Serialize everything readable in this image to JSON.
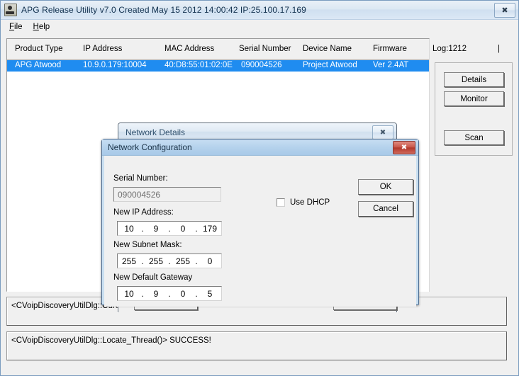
{
  "window": {
    "title": "APG Release Utility v7.0 Created May 15 2012 14:00:42   IP:25.100.17.169",
    "close_glyph": "✖",
    "icon_name": "app-icon"
  },
  "menu": {
    "items": [
      {
        "label": "File",
        "accel": "F"
      },
      {
        "label": "Help",
        "accel": "H"
      }
    ]
  },
  "device_list": {
    "columns": [
      "Product Type",
      "IP Address",
      "MAC Address",
      "Serial Number",
      "Device Name",
      "Firmware",
      "Log:1212",
      "|"
    ],
    "rows": [
      {
        "product_type": "APG Atwood",
        "ip_address": "10.9.0.179:10004",
        "mac_address": "40:D8:55:01:02:0E",
        "serial_number": "090004526",
        "device_name": "Project Atwood",
        "firmware": "Ver 2.4AT",
        "selected": true
      }
    ]
  },
  "side_buttons": {
    "details": "Details",
    "monitor": "Monitor",
    "scan": "Scan"
  },
  "log": {
    "lines": [
      "<CVoipDiscoveryUtilDlg::CurSelDev()> Device Is Atwood!",
      "<CVoipDiscoveryUtilDlg::Locate_Thread()> SUCCESS!"
    ]
  },
  "network_details": {
    "title": "Network Details",
    "close_glyph": "✖"
  },
  "network_configuration": {
    "title": "Network Configuration",
    "close_glyph": "✖",
    "serial_number": {
      "label": "Serial Number:",
      "value": "090004526"
    },
    "new_ip_address": {
      "label": "New IP Address:",
      "octets": [
        "10",
        "9",
        "0",
        "179"
      ]
    },
    "new_subnet_mask": {
      "label": "New Subnet Mask:",
      "octets": [
        "255",
        "255",
        "255",
        "0"
      ]
    },
    "new_default_gateway": {
      "label": "New Default Gateway",
      "octets": [
        "10",
        "9",
        "0",
        "5"
      ]
    },
    "use_dhcp": {
      "label": "Use DHCP",
      "checked": false
    },
    "ok_label": "OK",
    "cancel_label": "Cancel"
  },
  "colors": {
    "selection_blue": "#1f8cf0",
    "window_face": "#f0f0f0",
    "close_red": "#c9594c"
  }
}
